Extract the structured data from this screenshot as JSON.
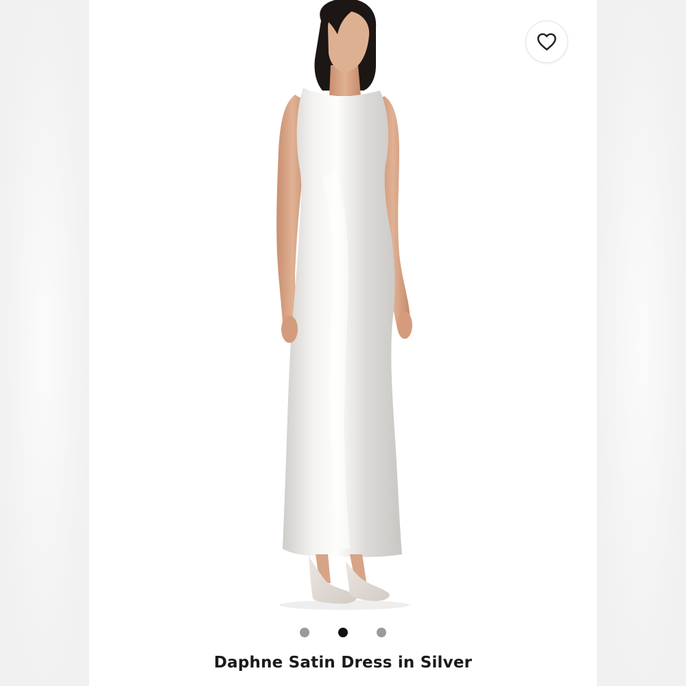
{
  "product": {
    "title": "Daphne Satin Dress in Silver"
  },
  "carousel": {
    "slides": [
      {
        "label": "slide-1",
        "active": false
      },
      {
        "label": "slide-2",
        "active": true
      },
      {
        "label": "slide-3",
        "active": false
      }
    ]
  },
  "icons": {
    "favorite": "heart-icon"
  },
  "colors": {
    "dress": "#e9e8e6",
    "skin": "#d9a889",
    "hair": "#1c1614",
    "active_dot": "#111111",
    "inactive_dot": "#9a9a9a"
  }
}
